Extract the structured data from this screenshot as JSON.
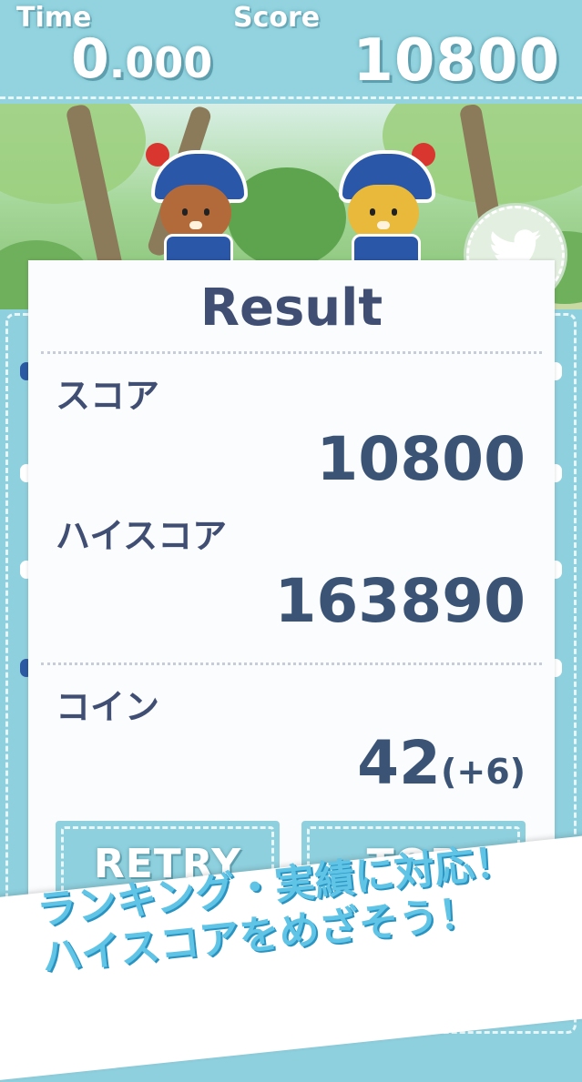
{
  "hud": {
    "time_label": "Time",
    "time_int": "0",
    "time_dec": ".000",
    "score_label": "Score",
    "score_value": "10800"
  },
  "result": {
    "title": "Result",
    "score_label": "スコア",
    "score_value": "10800",
    "highscore_label": "ハイスコア",
    "highscore_value": "163890",
    "coin_label": "コイン",
    "coin_value": "42",
    "coin_bonus": "(+6)"
  },
  "buttons": {
    "retry": "RETRY",
    "top": "TOP"
  },
  "share": {
    "icon": "twitter-icon"
  },
  "promo": {
    "line1": "ランキング・実績に対応！",
    "line2": "ハイスコアをめざそう！"
  },
  "colors": {
    "accent": "#8fd0de",
    "title_text": "#3f4e72",
    "promo_text": "#5fc4e6"
  }
}
